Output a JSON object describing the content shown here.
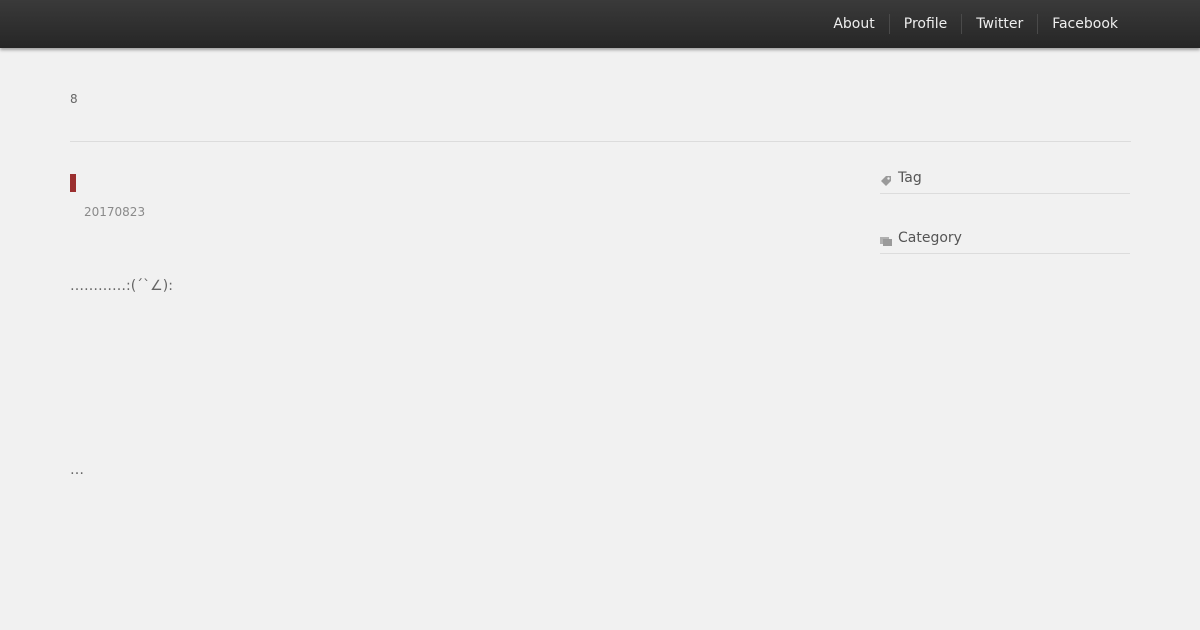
{
  "nav": {
    "items": [
      {
        "label": "About"
      },
      {
        "label": "Profile"
      },
      {
        "label": "Twitter"
      },
      {
        "label": "Facebook"
      }
    ]
  },
  "header": {
    "page_number": "8"
  },
  "post": {
    "date": "20170823",
    "body": "…………:(´`∠):",
    "more": "…"
  },
  "sidebar": {
    "tag": {
      "label": "Tag",
      "icon": "tag-icon"
    },
    "category": {
      "label": "Category",
      "icon": "folder-icon"
    }
  },
  "colors": {
    "accent": "#9b2f2f",
    "topbar": "#2e2e2e",
    "background": "#f1f1f1"
  }
}
